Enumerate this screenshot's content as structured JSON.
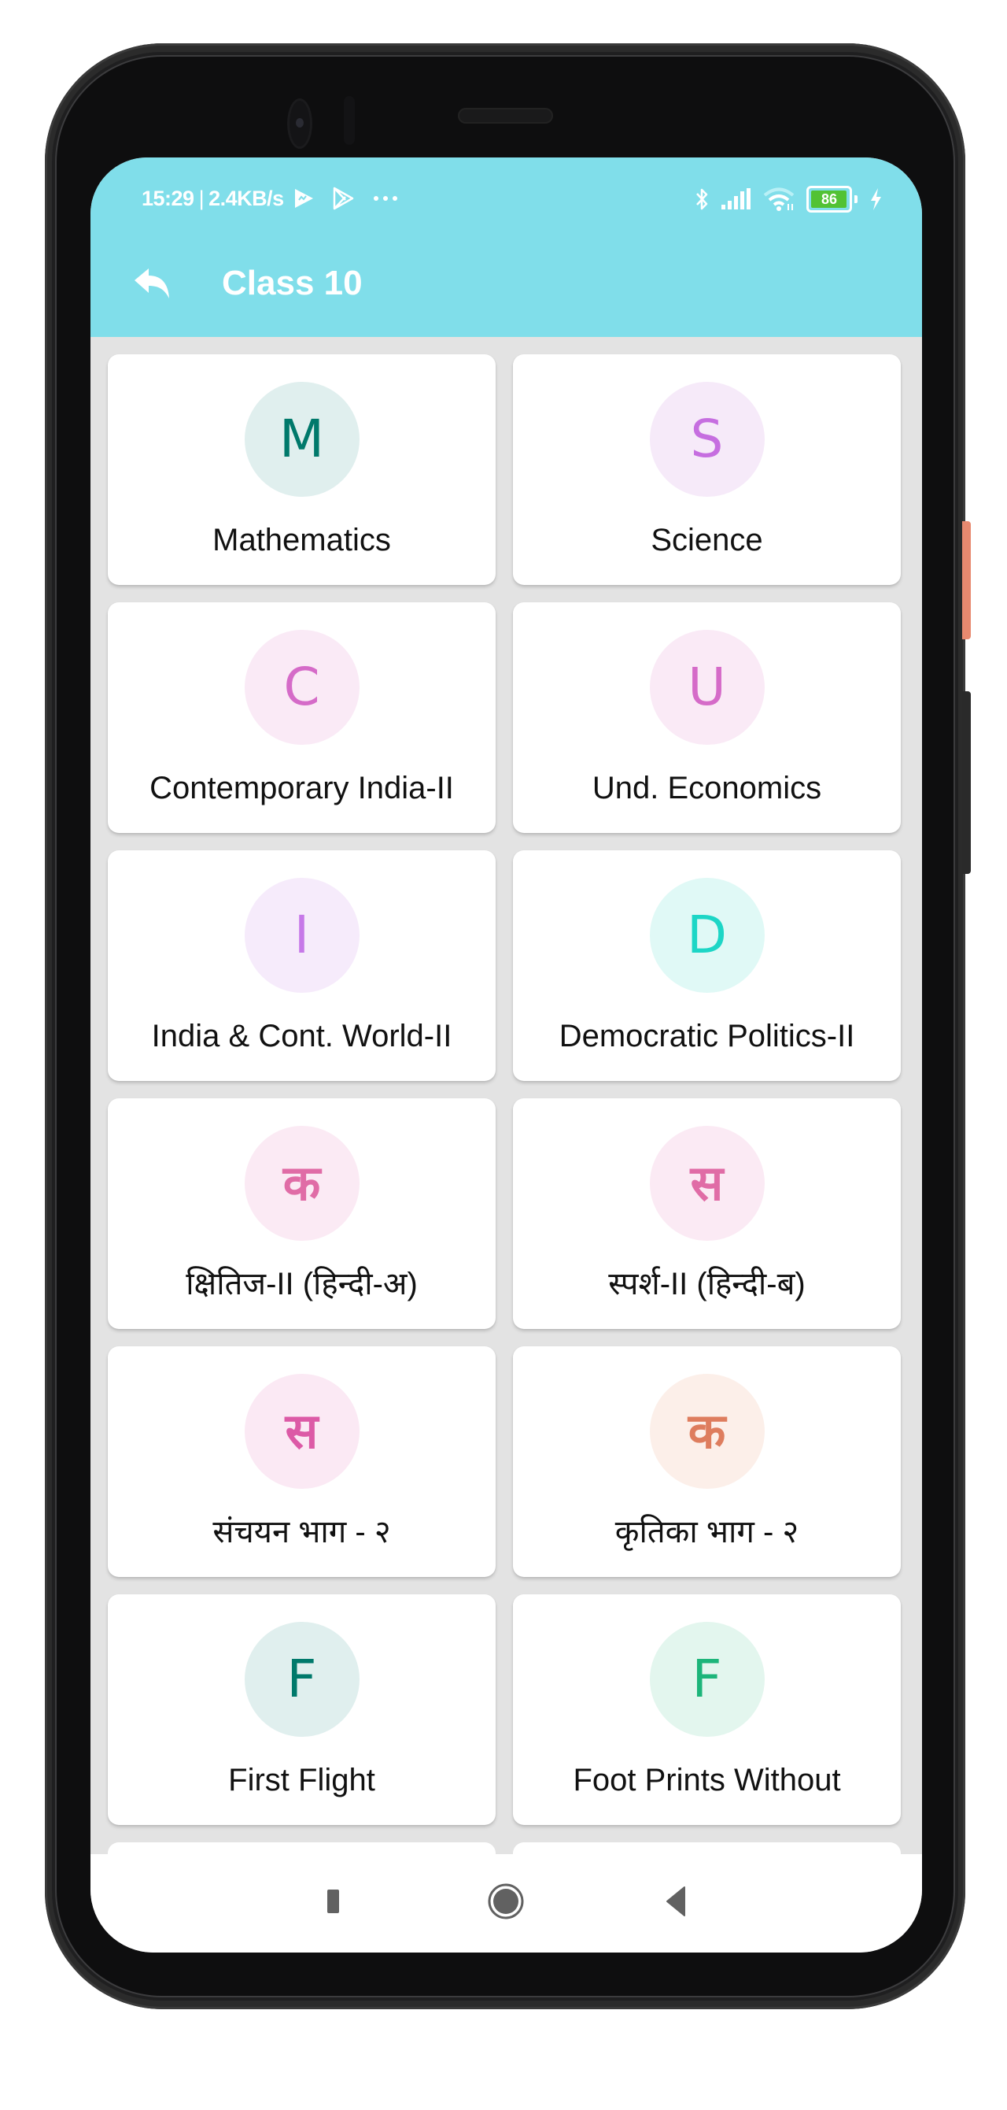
{
  "status_bar": {
    "time": "15:29",
    "separator": "|",
    "net_speed": "2.4KB/s",
    "left_icons": [
      "play-games-icon",
      "play-store-icon",
      "more-notifications-icon"
    ],
    "right_icons": [
      "bluetooth-icon",
      "cellular-signal-icon",
      "wifi-icon",
      "battery-icon",
      "charging-icon"
    ],
    "battery_level": "86",
    "battery_percent": 86
  },
  "appbar": {
    "back_icon": "reply-back-arrow-icon",
    "title": "Class 10",
    "background": "#80deea"
  },
  "subjects": [
    {
      "initial": "M",
      "label": "Mathematics",
      "bg": "#e0efee",
      "fg": "#00796b",
      "script": "latin"
    },
    {
      "initial": "S",
      "label": "Science",
      "bg": "#f6eaf9",
      "fg": "#c66ee0",
      "script": "latin"
    },
    {
      "initial": "C",
      "label": "Contemporary India-II",
      "bg": "#faeaf6",
      "fg": "#d56bc8",
      "script": "latin"
    },
    {
      "initial": "U",
      "label": "Und. Economics",
      "bg": "#faeaf6",
      "fg": "#d56bc8",
      "script": "latin"
    },
    {
      "initial": "I",
      "label": "India & Cont. World-II",
      "bg": "#f6ebfb",
      "fg": "#c678e8",
      "script": "latin"
    },
    {
      "initial": "D",
      "label": "Democratic Politics-II",
      "bg": "#e0f9f6",
      "fg": "#1dd6c6",
      "script": "latin"
    },
    {
      "initial": "क",
      "label": "क्षितिज-II (हिन्दी-अ)",
      "bg": "#fbeaf4",
      "fg": "#e06ca6",
      "script": "deva"
    },
    {
      "initial": "स",
      "label": "स्पर्श-II (हिन्दी-ब)",
      "bg": "#fbeaf4",
      "fg": "#e06ca6",
      "script": "deva"
    },
    {
      "initial": "स",
      "label": "संचयन भाग - २",
      "bg": "#fbe9f4",
      "fg": "#dc5aa6",
      "script": "deva"
    },
    {
      "initial": "क",
      "label": "कृतिका भाग - २",
      "bg": "#fcefe9",
      "fg": "#de7d5e",
      "script": "deva"
    },
    {
      "initial": "F",
      "label": "First Flight",
      "bg": "#e0efee",
      "fg": "#00796b",
      "script": "latin"
    },
    {
      "initial": "F",
      "label": "Foot Prints Without",
      "bg": "#e3f6ee",
      "fg": "#1db57a",
      "script": "latin"
    }
  ],
  "navigation_bar": {
    "buttons": [
      {
        "name": "recent-apps",
        "icon": "square-icon"
      },
      {
        "name": "home",
        "icon": "circle-home-icon"
      },
      {
        "name": "back",
        "icon": "triangle-back-icon"
      }
    ]
  }
}
